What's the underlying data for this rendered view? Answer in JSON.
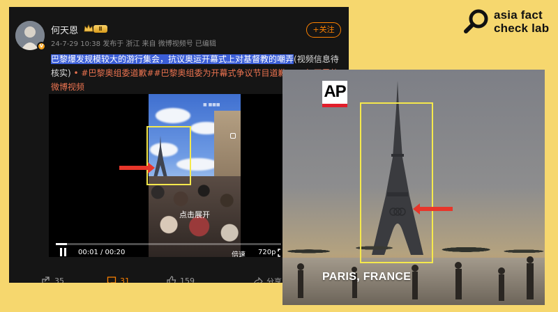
{
  "brand": {
    "line1": "asia fact",
    "line2": "check lab"
  },
  "post": {
    "username": "何天恩",
    "level_badge": "Ⅱ",
    "verified_badge": "V",
    "meta": "24-7-29 10:38  发布于 浙江  来自 微博视频号  已编辑",
    "follow_label": "+关注",
    "text_highlighted": "巴黎爆发规模较大的游行集会，抗议奥运开幕式上对基督教的嘲弄",
    "text_rest": "(视频信息待核实)",
    "text_tags": " • #巴黎奥组委道歉##巴黎奥组委为开幕式争议节目道歉#",
    "text_link": "何天恩的微博视频",
    "video": {
      "expand_label": "点击展开",
      "time": "00:01 / 00:20",
      "progress": 0.05,
      "speed_label": "倍速",
      "quality_label": "720p"
    },
    "actions": {
      "shares": "35",
      "comments": "31",
      "likes": "159",
      "share_label": "分享"
    }
  },
  "ap_panel": {
    "logo": "AP",
    "caption": "PARIS, FRANCE"
  },
  "colors": {
    "background": "#f6d76e",
    "highlight": "#f5e94c",
    "arrow": "#e8362a",
    "weibo_orange": "#ff8200"
  }
}
